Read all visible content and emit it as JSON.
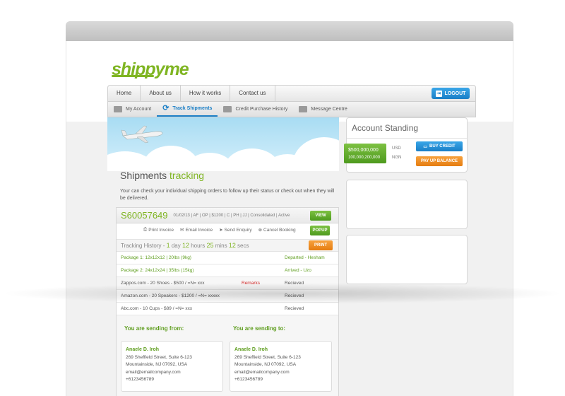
{
  "brand": {
    "logo_text": "shippyme",
    "accent": "#7fb522",
    "blue": "#1a7fc7",
    "orange": "#e57c10"
  },
  "topnav": {
    "items": [
      "Home",
      "About us",
      "How it works",
      "Contact us"
    ],
    "logout": "LOGOUT"
  },
  "subnav": {
    "items": [
      {
        "label": "My Account",
        "icon": "wallet-icon"
      },
      {
        "label": "Track Shipments",
        "icon": "refresh-icon"
      },
      {
        "label": "Credit Purchase History",
        "icon": "card-icon"
      },
      {
        "label": "Message Centre",
        "icon": "chat-icon"
      }
    ]
  },
  "main": {
    "title_a": "Shipments ",
    "title_b": "tracking",
    "intro": "Your can check your individual shipping orders to follow up their status or check out when they will be delivered."
  },
  "shipment": {
    "id": "S60057649",
    "meta": "01/02/13 | AF | OP | $1200 | C | PH | JJ | Consolidated | Active",
    "view": "VIEW",
    "popup": "POPUP",
    "print": "PRINT",
    "actions": [
      "Print Invoice",
      "Email Invoice",
      "Send Enquiry",
      "Cancel Booking"
    ],
    "tracking": {
      "label": "Tracking History - ",
      "d": "1",
      "du": " day ",
      "h": "12",
      "hu": " hours ",
      "m": "25",
      "mu": " mins ",
      "s": "12",
      "su": " secs"
    },
    "rows": [
      {
        "item": "Package 1: 12x12x12 | 20lbs (9kg)",
        "remark": "",
        "status": "Departed - Hesham"
      },
      {
        "item": "Package 2: 24x12x24 | 35lbs (15kg)",
        "remark": "",
        "status": "Arrived - Uzo"
      },
      {
        "item": "Zappos.com - 20 Shoes - $500 / =N= xxx",
        "remark": "Remarks",
        "status": "Recieved"
      },
      {
        "item": "Amazon.com - 20 Speakers - $1200 / =N= xxxxx",
        "remark": "",
        "status": "Recieved"
      },
      {
        "item": "Abc.com - 10 Cups - $89 / =N= xxx",
        "remark": "",
        "status": "Recieved"
      }
    ],
    "from": {
      "heading": "You are sending from:",
      "name": "Anaele D. Iroh",
      "street": "269 Sheffield Street, Suite 6-123",
      "city": "Mountainside, NJ 07092, USA",
      "email": "email@emailcompany.com",
      "phone": "+6123456789"
    },
    "to": {
      "heading": "You are sending to:",
      "name": "Anaele D. Iroh",
      "street": "269 Sheffield Street, Suite 6-123",
      "city": "Mountainside, NJ 07092, USA",
      "email": "email@emailcompany.com",
      "phone": "+6123456789"
    }
  },
  "account": {
    "title": "Account Standing",
    "usd": "$500,000,000",
    "ngn": "100,000,200,000",
    "usd_label": "USD",
    "ngn_label": "NGN",
    "buy": "BUY CREDIT",
    "pay": "PAY UP BALANCE"
  }
}
